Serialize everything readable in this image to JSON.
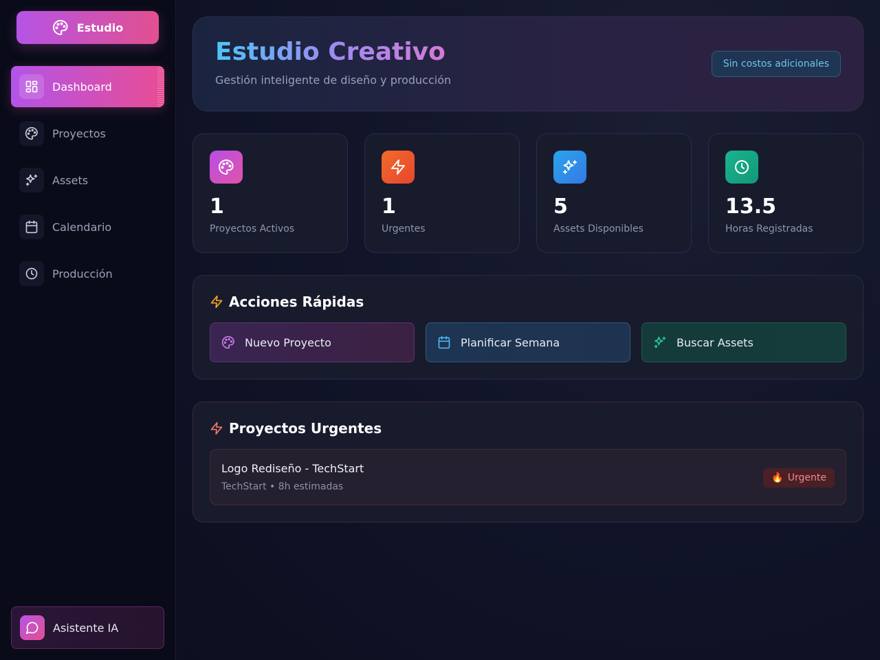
{
  "sidebar": {
    "brand": "Estudio",
    "items": [
      {
        "label": "Dashboard",
        "icon": "dashboard-icon",
        "active": true
      },
      {
        "label": "Proyectos",
        "icon": "palette-icon"
      },
      {
        "label": "Assets",
        "icon": "sparkles-icon"
      },
      {
        "label": "Calendario",
        "icon": "calendar-icon"
      },
      {
        "label": "Producción",
        "icon": "clock-icon"
      }
    ],
    "assistant": "Asistente IA"
  },
  "header": {
    "title": "Estudio Creativo",
    "subtitle": "Gestión inteligente de diseño y producción",
    "badge": "Sin costos adicionales"
  },
  "stats": [
    {
      "value": "1",
      "label": "Proyectos Activos",
      "icon": "palette-icon",
      "color": "#c04ee0"
    },
    {
      "value": "1",
      "label": "Urgentes",
      "icon": "zap-icon",
      "color": "#f2552c"
    },
    {
      "value": "5",
      "label": "Assets Disponibles",
      "icon": "sparkles-icon",
      "color": "#2f8fe8"
    },
    {
      "value": "13.5",
      "label": "Horas Registradas",
      "icon": "clock-icon",
      "color": "#18a884"
    }
  ],
  "quick_actions": {
    "title": "Acciones Rápidas",
    "actions": [
      {
        "label": "Nuevo Proyecto",
        "icon": "palette-icon"
      },
      {
        "label": "Planificar Semana",
        "icon": "calendar-icon"
      },
      {
        "label": "Buscar Assets",
        "icon": "sparkles-icon"
      }
    ]
  },
  "urgent_projects": {
    "title": "Proyectos Urgentes",
    "items": [
      {
        "name": "Logo Rediseño - TechStart",
        "meta": "TechStart • 8h estimadas",
        "badge": "Urgente",
        "badge_icon": "🔥"
      }
    ]
  }
}
